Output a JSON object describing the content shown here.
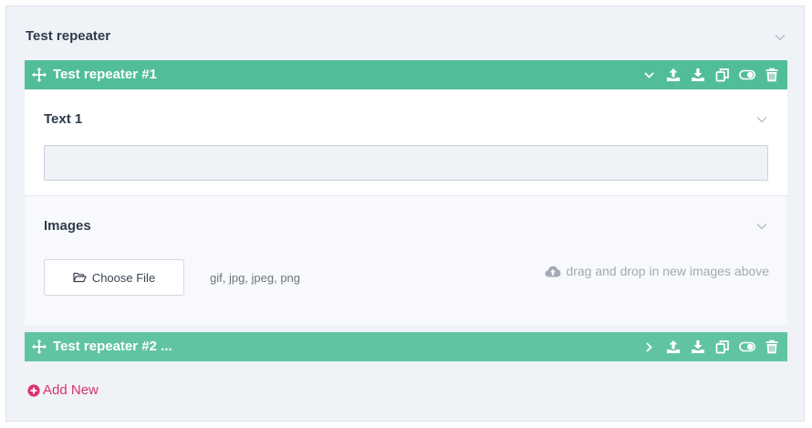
{
  "field": {
    "title": "Test repeater",
    "chevron_icon": "chevron-down-icon"
  },
  "items": [
    {
      "title": "Test repeater #1",
      "expanded": true,
      "tools": [
        "chevron-down-icon",
        "upload-icon",
        "download-icon",
        "duplicate-icon",
        "toggle-icon",
        "trash-icon"
      ]
    },
    {
      "title": "Test repeater #2 ...",
      "expanded": false,
      "tools": [
        "chevron-right-icon",
        "upload-icon",
        "download-icon",
        "duplicate-icon",
        "toggle-icon",
        "trash-icon"
      ]
    }
  ],
  "text1": {
    "label": "Text 1",
    "value": "",
    "placeholder": ""
  },
  "images": {
    "label": "Images",
    "choose_file_label": "Choose File",
    "file_types": "gif, jpg, jpeg, png",
    "drag_drop_text": "drag and drop in new images above"
  },
  "add_new": {
    "label": "Add New"
  },
  "colors": {
    "bar": "#52be98",
    "bar_collapsed": "#61c4a1",
    "accent": "#d8336d",
    "panel": "#eff2f7"
  }
}
